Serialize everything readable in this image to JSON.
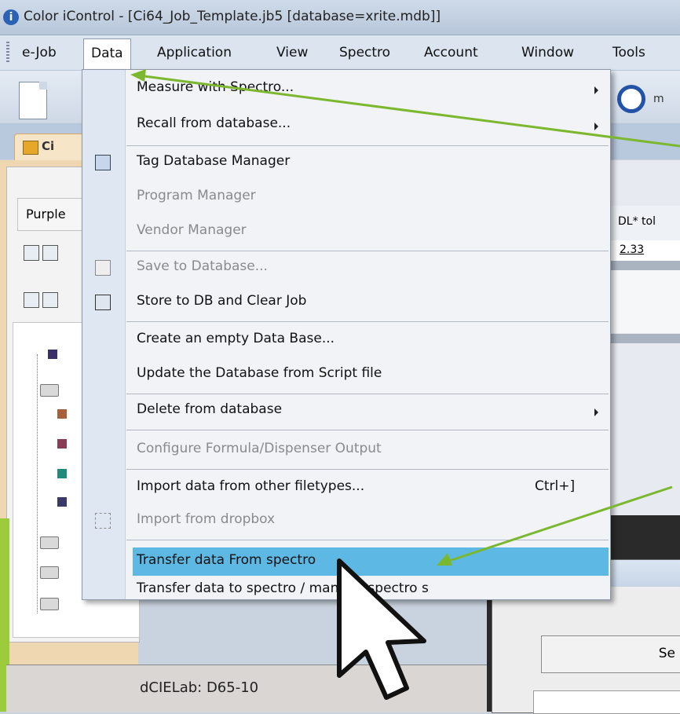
{
  "window": {
    "title": "Color iControl - [Ci64_Job_Template.jb5 [database=xrite.mdb]]"
  },
  "menubar": {
    "items": [
      "e-Job",
      "Data",
      "Application",
      "View",
      "Spectro",
      "Account",
      "Window",
      "Tools"
    ]
  },
  "toolbar": {
    "right_label": "m"
  },
  "doc_tab": {
    "label": "Ci"
  },
  "left_panel": {
    "name_box": "Purple"
  },
  "grid": {
    "header": "DL* tol",
    "value": "2.33"
  },
  "status": {
    "text": "dCIELab: D65-10"
  },
  "dialog": {
    "button_text": "Se"
  },
  "data_menu": {
    "items": [
      {
        "label": "Measure with Spectro...",
        "enabled": true,
        "submenu": true
      },
      {
        "label": "Recall from database...",
        "enabled": true,
        "submenu": true
      },
      {
        "label": "Tag Database Manager",
        "enabled": true,
        "icon": "database-tag-icon"
      },
      {
        "label": "Program Manager",
        "enabled": false
      },
      {
        "label": "Vendor Manager",
        "enabled": false
      },
      {
        "label": "Save to Database...",
        "enabled": false,
        "icon": "save-db-icon"
      },
      {
        "label": "Store to DB and Clear Job",
        "enabled": true,
        "icon": "store-db-icon"
      },
      {
        "label": "Create an empty Data Base...",
        "enabled": true
      },
      {
        "label": "Update the Database from Script file",
        "enabled": true
      },
      {
        "label": "Delete from database",
        "enabled": true,
        "submenu": true
      },
      {
        "label": "Configure Formula/Dispenser Output",
        "enabled": false
      },
      {
        "label": "Import data from other filetypes...",
        "enabled": true,
        "shortcut": "Ctrl+]"
      },
      {
        "label": "Import from dropbox",
        "enabled": false,
        "icon": "dropbox-icon"
      },
      {
        "label": "Transfer data From spectro",
        "enabled": true,
        "highlighted": true
      },
      {
        "label": "Transfer data to spectro / manage spectro s",
        "enabled": true
      }
    ]
  },
  "colors": {
    "highlight": "#5db9e4",
    "annotation_arrow": "#7cb82f",
    "menu_gutter": "#dfe7f3"
  }
}
